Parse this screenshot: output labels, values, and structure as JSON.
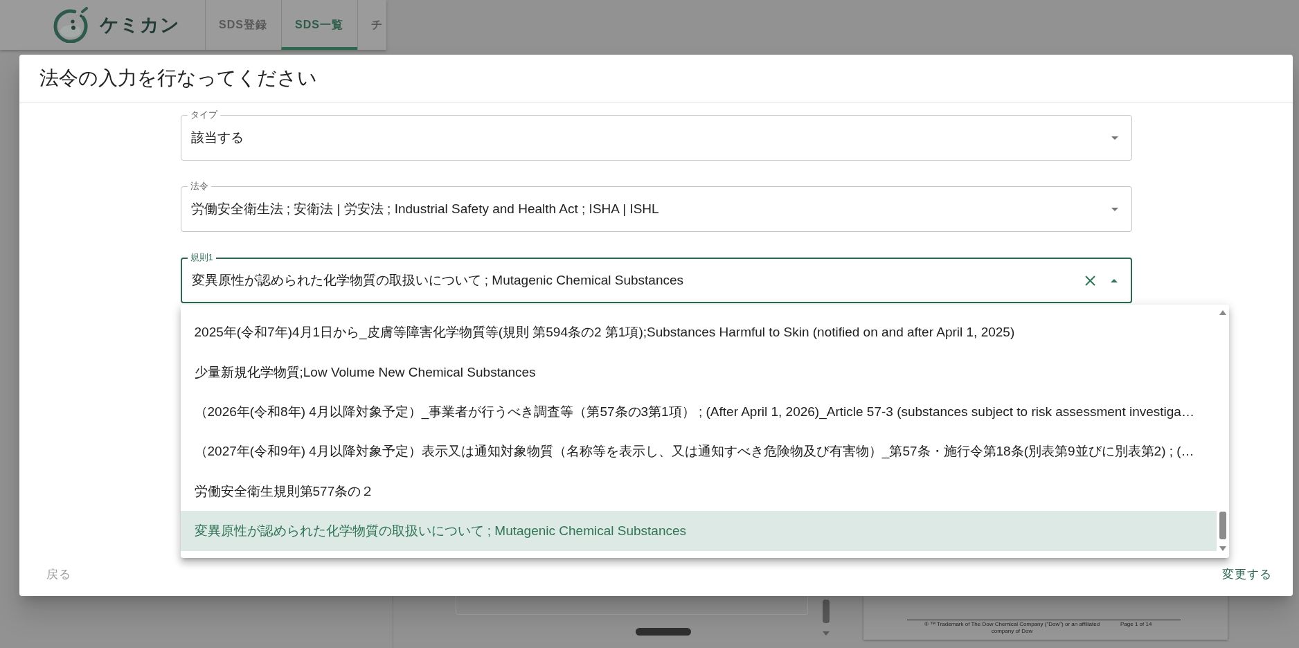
{
  "header": {
    "logo_text": "ケミカン",
    "tabs": [
      {
        "label": "SDS登録",
        "selected": false
      },
      {
        "label": "SDS一覧",
        "selected": true
      },
      {
        "label": "チ",
        "selected": false
      }
    ]
  },
  "dialog": {
    "title": "法令の入力を行なってください",
    "fields": [
      {
        "label": "タイプ",
        "value": "該当する",
        "expanded": false
      },
      {
        "label": "法令",
        "value": "労働安全衛生法 ; 安衛法 | 労安法 ; Industrial Safety and Health Act ; ISHA | ISHL",
        "expanded": false
      },
      {
        "label": "規則1",
        "value": "変異原性が認められた化学物質の取扱いについて ; Mutagenic Chemical Substances",
        "expanded": true,
        "options": [
          {
            "label": "2025年(令和7年)4月1日から_皮膚等障害化学物質等(規則 第594条の2 第1項);Substances Harmful to Skin (notified on and after April 1, 2025)",
            "selected": false
          },
          {
            "label": "少量新規化学物質;Low Volume New Chemical Substances",
            "selected": false
          },
          {
            "label": "（2026年(令和8年) 4月以降対象予定）_事業者が行うべき調査等（第57条の3第1項） ; (After April 1, 2026)_Article 57-3 (substances subject to risk assessment investiga…",
            "selected": false
          },
          {
            "label": "（2027年(令和9年) 4月以降対象予定）表示又は通知対象物質（名称等を表示し、又は通知すべき危険物及び有害物）_第57条・施行令第18条(別表第9並びに別表第2) ; (…",
            "selected": false
          },
          {
            "label": "労働安全衛生規則第577条の２",
            "selected": false
          },
          {
            "label": "変異原性が認められた化学物質の取扱いについて ; Mutagenic Chemical Substances",
            "selected": true
          }
        ]
      }
    ],
    "actions": {
      "back": "戻る",
      "submit": "変更する"
    }
  },
  "background_page": {
    "document_footer": {
      "trademark": "® ™ Trademark of The Dow Chemical Company (\"Dow\") or an affiliated company of Dow",
      "page": "Page 1 of 14"
    }
  }
}
